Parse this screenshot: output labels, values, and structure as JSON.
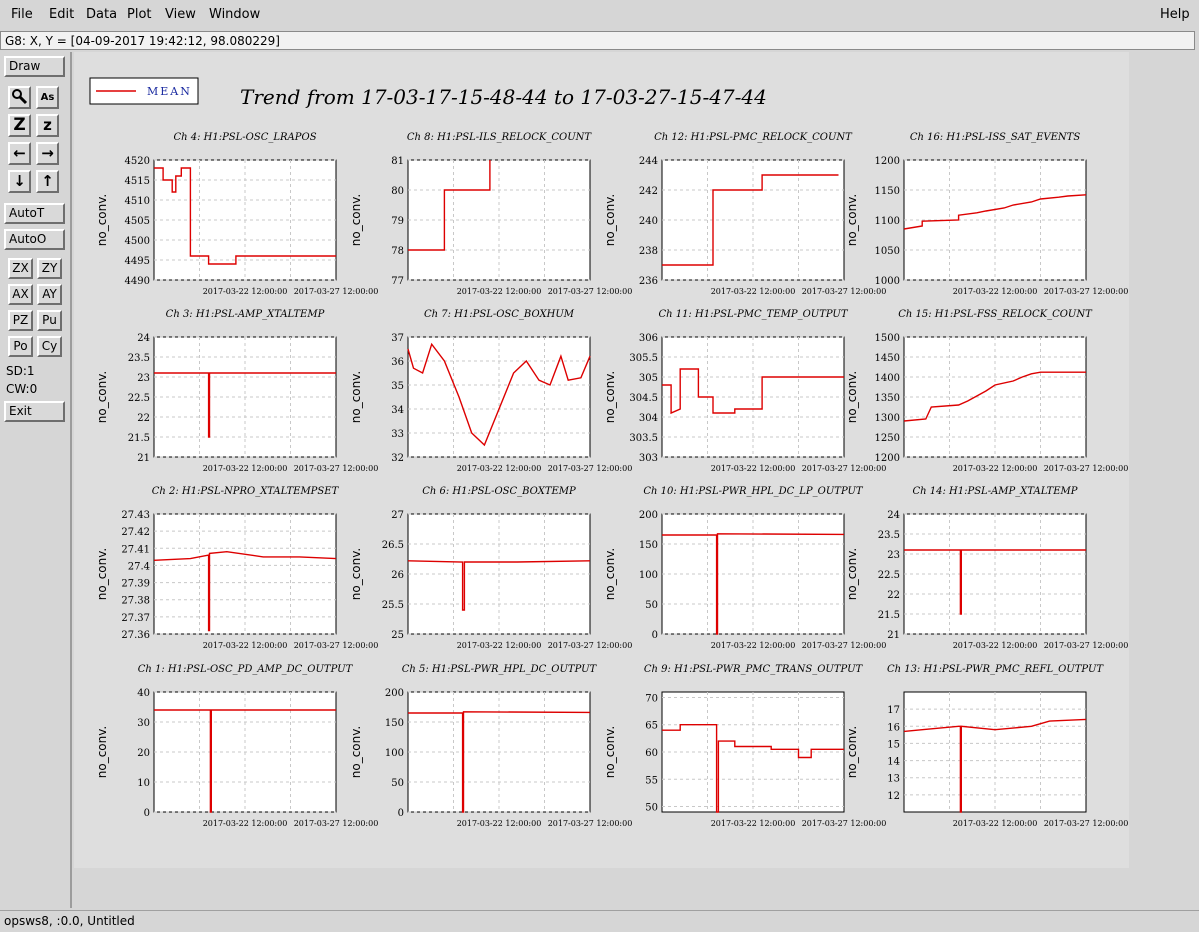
{
  "menu": {
    "file": "File",
    "edit": "Edit",
    "data": "Data",
    "plot": "Plot",
    "view": "View",
    "window": "Window",
    "help": "Help"
  },
  "status_line": "G8: X, Y = [04-09-2017 19:42:12, 98.080229]",
  "sidebar": {
    "draw": "Draw",
    "autot": "AutoT",
    "autoo": "AutoO",
    "zx": "ZX",
    "zy": "ZY",
    "ax": "AX",
    "ay": "AY",
    "pz": "PZ",
    "pu": "Pu",
    "po": "Po",
    "cy": "Cy",
    "sd": "SD:1",
    "cw": "CW:0",
    "exit": "Exit",
    "icons": {
      "zoom_z": "Z",
      "zoom_z_small": "z",
      "left_arrow": "←",
      "right_arrow": "→",
      "down_arrow": "↓",
      "up_arrow": "↑",
      "as_label": "As"
    }
  },
  "bottom_status": "opsws8, :0.0, Untitled",
  "colors": {
    "trace": "#dd0000",
    "legend_text": "#1a2aa0"
  },
  "chart_data": {
    "type": "line",
    "title": "Trend from 17-03-17-15-48-44 to 17-03-27-15-47-44",
    "legend": "MEAN",
    "ylabel": "no_conv.",
    "x_tick_labels": [
      "2017-03-22 12:00:00",
      "2017-03-27 12:00:00"
    ],
    "x_range": [
      "2017-03-17 15:48:44",
      "2017-03-27 15:47:44"
    ],
    "grid": true,
    "panels": [
      {
        "title": "Ch 4: H1:PSL-OSC_LRAPOS",
        "ylim": [
          4490,
          4520
        ],
        "yticks": [
          4490,
          4495,
          4500,
          4505,
          4510,
          4515,
          4520
        ],
        "x": [
          0,
          0.05,
          0.05,
          0.1,
          0.1,
          0.12,
          0.12,
          0.15,
          0.15,
          0.2,
          0.2,
          0.3,
          0.3,
          0.45,
          0.45,
          1
        ],
        "y": [
          4518,
          4518,
          4515,
          4515,
          4512,
          4512,
          4516,
          4516,
          4518,
          4518,
          4496,
          4496,
          4494,
          4494,
          4496,
          4496
        ]
      },
      {
        "title": "Ch 8: H1:PSL-ILS_RELOCK_COUNT",
        "ylim": [
          77,
          81
        ],
        "yticks": [
          77,
          78,
          79,
          80,
          81
        ],
        "x": [
          0,
          0.2,
          0.2,
          0.45,
          0.45
        ],
        "y": [
          78,
          78,
          80,
          80,
          81
        ]
      },
      {
        "title": "Ch 12: H1:PSL-PMC_RELOCK_COUNT",
        "ylim": [
          236,
          244
        ],
        "yticks": [
          236,
          238,
          240,
          242,
          244
        ],
        "x": [
          0,
          0.28,
          0.28,
          0.55,
          0.55,
          0.97
        ],
        "y": [
          237,
          237,
          242,
          242,
          243,
          243
        ]
      },
      {
        "title": "Ch 16: H1:PSL-ISS_SAT_EVENTS",
        "ylim": [
          1000,
          1200
        ],
        "yticks": [
          1000,
          1050,
          1100,
          1150,
          1200
        ],
        "x": [
          0,
          0.1,
          0.1,
          0.3,
          0.3,
          0.4,
          0.45,
          0.55,
          0.6,
          0.7,
          0.75,
          0.85,
          0.9,
          1
        ],
        "y": [
          1085,
          1090,
          1098,
          1100,
          1108,
          1112,
          1115,
          1120,
          1125,
          1130,
          1135,
          1138,
          1140,
          1142
        ]
      },
      {
        "title": "Ch 3: H1:PSL-AMP_XTALTEMP",
        "ylim": [
          21,
          24
        ],
        "yticks": [
          21,
          21.5,
          22,
          22.5,
          23,
          23.5,
          24
        ],
        "x": [
          0,
          0.3,
          0.3,
          0.305,
          0.305,
          1
        ],
        "y": [
          23.1,
          23.1,
          21.5,
          21.5,
          23.1,
          23.1
        ]
      },
      {
        "title": "Ch 7: H1:PSL-OSC_BOXHUM",
        "ylim": [
          32,
          37
        ],
        "yticks": [
          32,
          33,
          34,
          35,
          36,
          37
        ],
        "x": [
          0,
          0.03,
          0.08,
          0.13,
          0.2,
          0.28,
          0.35,
          0.42,
          0.5,
          0.58,
          0.65,
          0.72,
          0.78,
          0.84,
          0.88,
          0.95,
          1
        ],
        "y": [
          36.5,
          35.7,
          35.5,
          36.7,
          36,
          34.5,
          33,
          32.5,
          34,
          35.5,
          36,
          35.2,
          35,
          36.2,
          35.2,
          35.3,
          36.2
        ]
      },
      {
        "title": "Ch 11: H1:PSL-PMC_TEMP_OUTPUT",
        "ylim": [
          303,
          306
        ],
        "yticks": [
          303,
          303.5,
          304,
          304.5,
          305,
          305.5,
          306
        ],
        "x": [
          0,
          0.05,
          0.05,
          0.1,
          0.1,
          0.2,
          0.2,
          0.28,
          0.28,
          0.4,
          0.4,
          0.55,
          0.55,
          1
        ],
        "y": [
          304.8,
          304.8,
          304.1,
          304.2,
          305.2,
          305.2,
          304.5,
          304.5,
          304.1,
          304.1,
          304.2,
          304.2,
          305,
          305
        ]
      },
      {
        "title": "Ch 15: H1:PSL-FSS_RELOCK_COUNT",
        "ylim": [
          1200,
          1500
        ],
        "yticks": [
          1200,
          1250,
          1300,
          1350,
          1400,
          1450,
          1500
        ],
        "x": [
          0,
          0.12,
          0.15,
          0.3,
          0.35,
          0.45,
          0.5,
          0.6,
          0.65,
          0.7,
          0.75,
          1
        ],
        "y": [
          1290,
          1295,
          1325,
          1330,
          1340,
          1365,
          1380,
          1390,
          1400,
          1408,
          1412,
          1412
        ]
      },
      {
        "title": "Ch 2: H1:PSL-NPRO_XTALTEMPSET",
        "ylim": [
          27.36,
          27.43
        ],
        "yticks": [
          27.36,
          27.37,
          27.38,
          27.39,
          27.4,
          27.41,
          27.42,
          27.43
        ],
        "x": [
          0,
          0.2,
          0.3,
          0.3,
          0.305,
          0.305,
          0.4,
          0.6,
          0.8,
          1
        ],
        "y": [
          27.403,
          27.404,
          27.406,
          27.362,
          27.362,
          27.407,
          27.408,
          27.405,
          27.405,
          27.404
        ]
      },
      {
        "title": "Ch 6: H1:PSL-OSC_BOXTEMP",
        "ylim": [
          25,
          27
        ],
        "yticks": [
          25,
          25.5,
          26,
          26.5,
          27
        ],
        "x": [
          0,
          0.3,
          0.3,
          0.31,
          0.31,
          0.6,
          1
        ],
        "y": [
          26.22,
          26.2,
          25.4,
          25.4,
          26.2,
          26.2,
          26.22
        ]
      },
      {
        "title": "Ch 10: H1:PSL-PWR_HPL_DC_LP_OUTPUT",
        "ylim": [
          0,
          200
        ],
        "yticks": [
          0,
          50,
          100,
          150,
          200
        ],
        "x": [
          0,
          0.3,
          0.3,
          0.305,
          0.305,
          1
        ],
        "y": [
          165,
          165,
          0,
          0,
          167,
          166
        ]
      },
      {
        "title": "Ch 14: H1:PSL-AMP_XTALTEMP",
        "ylim": [
          21,
          24
        ],
        "yticks": [
          21,
          21.5,
          22,
          22.5,
          23,
          23.5,
          24
        ],
        "x": [
          0,
          0.31,
          0.31,
          0.315,
          0.315,
          1
        ],
        "y": [
          23.1,
          23.1,
          21.5,
          21.5,
          23.1,
          23.1
        ]
      },
      {
        "title": "Ch 1: H1:PSL-OSC_PD_AMP_DC_OUTPUT",
        "ylim": [
          0,
          40
        ],
        "yticks": [
          0,
          10,
          20,
          30,
          40
        ],
        "x": [
          0,
          0.31,
          0.31,
          0.315,
          0.315,
          1
        ],
        "y": [
          34,
          34,
          0,
          0,
          34,
          34
        ]
      },
      {
        "title": "Ch 5: H1:PSL-PWR_HPL_DC_OUTPUT",
        "ylim": [
          0,
          200
        ],
        "yticks": [
          0,
          50,
          100,
          150,
          200
        ],
        "x": [
          0,
          0.3,
          0.3,
          0.305,
          0.305,
          1
        ],
        "y": [
          165,
          165,
          0,
          0,
          167,
          166
        ]
      },
      {
        "title": "Ch 9: H1:PSL-PWR_PMC_TRANS_OUTPUT",
        "ylim": [
          49,
          71
        ],
        "yticks": [
          50,
          55,
          60,
          65,
          70
        ],
        "x": [
          0,
          0.1,
          0.1,
          0.3,
          0.3,
          0.31,
          0.31,
          0.4,
          0.4,
          0.6,
          0.6,
          0.75,
          0.75,
          0.82,
          0.82,
          1
        ],
        "y": [
          64,
          64,
          65,
          65,
          49,
          49,
          62,
          62,
          61,
          61,
          60.5,
          60.5,
          59,
          59,
          60.5,
          60.5
        ]
      },
      {
        "title": "Ch 13: H1:PSL-PWR_PMC_REFL_OUTPUT",
        "ylim": [
          11,
          18
        ],
        "yticks": [
          12,
          13,
          14,
          15,
          16,
          17
        ],
        "x": [
          0,
          0.1,
          0.3,
          0.31,
          0.31,
          0.315,
          0.315,
          0.5,
          0.7,
          0.8,
          1
        ],
        "y": [
          15.7,
          15.8,
          16,
          16,
          11,
          11,
          16,
          15.8,
          16,
          16.3,
          16.4
        ]
      }
    ]
  }
}
